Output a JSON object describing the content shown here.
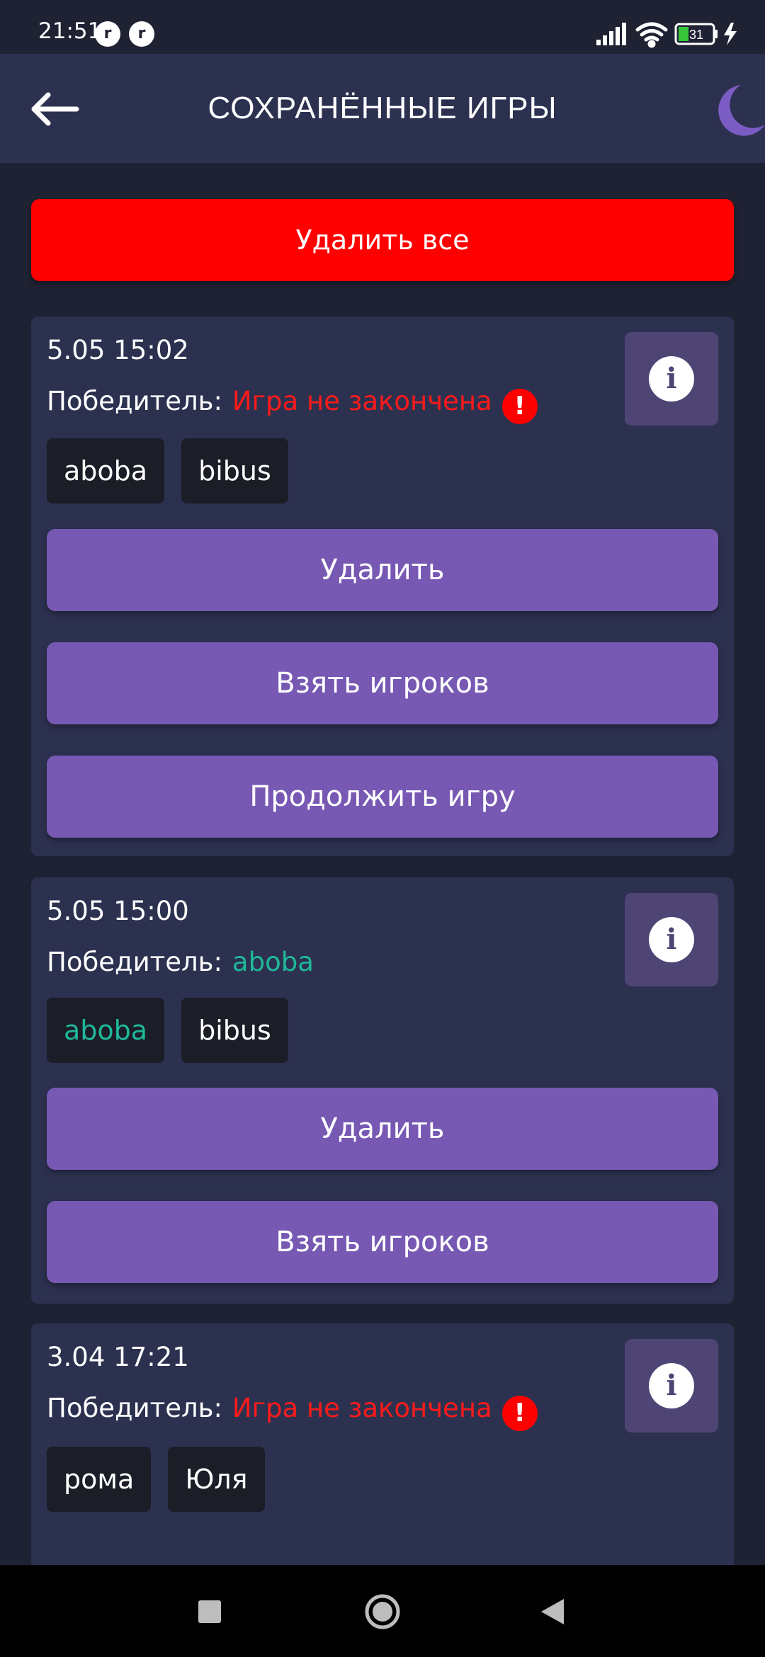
{
  "status_bar": {
    "time": "21:51",
    "app_icon_glyph": "r",
    "battery_level": "31",
    "icons": [
      "signal-icon",
      "wifi-icon",
      "battery-icon",
      "charging-icon"
    ]
  },
  "app_bar": {
    "title": "СОХРАНЁННЫЕ ИГРЫ",
    "back_icon": "arrow-left-icon",
    "theme_icon": "moon-icon"
  },
  "delete_all_label": "Удалить все",
  "games": [
    {
      "date": "5.05 15:02",
      "winner_label": "Победитель:",
      "winner_value": "Игра не закончена",
      "finished": false,
      "players": [
        "aboba",
        "bibus"
      ],
      "actions": [
        "Удалить",
        "Взять игроков",
        "Продолжить игру"
      ]
    },
    {
      "date": "5.05 15:00",
      "winner_label": "Победитель:",
      "winner_value": "aboba",
      "finished": true,
      "players": [
        "aboba",
        "bibus"
      ],
      "actions": [
        "Удалить",
        "Взять игроков"
      ]
    },
    {
      "date": "3.04 17:21",
      "winner_label": "Победитель:",
      "winner_value": "Игра не закончена",
      "finished": false,
      "players": [
        "рома",
        "Юля"
      ],
      "actions": []
    }
  ],
  "info_icon_glyph": "i",
  "warning_icon_glyph": "!",
  "colors": {
    "background": "#1f2233",
    "card": "#2d3150",
    "danger": "#ff0000",
    "accent": "#7759b4",
    "winner_green": "#1fb89a",
    "moon": "#7b5cc4"
  }
}
